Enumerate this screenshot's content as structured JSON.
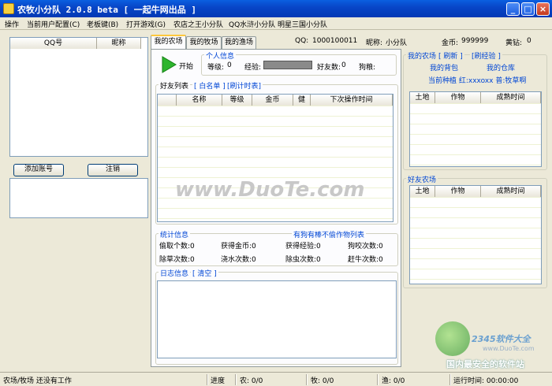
{
  "window": {
    "title": "农牧小分队 2.0.8 beta [ 一起牛网出品 ]"
  },
  "menu": [
    "操作",
    "当前用户配置(C)",
    "老板键(B)",
    "打开游戏(G)",
    "农店之王小分队",
    "QQ水浒小分队",
    "明星三国小分队"
  ],
  "accounts": {
    "col_qq": "QQ号",
    "col_nick": "昵称"
  },
  "buttons": {
    "add_account": "添加账号",
    "logout": "注销",
    "start": "开始"
  },
  "tabs": [
    "我的农场",
    "我的牧场",
    "我的渔场"
  ],
  "info_bar": {
    "qq_label": "QQ:",
    "qq_value": "1000100011",
    "nick_label": "昵称:",
    "nick_value": "小分队",
    "gold_label": "金币:",
    "gold_value": "999999",
    "diamond_label": "黄钻:",
    "diamond_value": "0"
  },
  "personal": {
    "title": "个人信息",
    "level_label": "等级:",
    "level_value": "0",
    "exp_label": "经验:",
    "exp_progress": 1.0,
    "friends_label": "好友数:",
    "friends_value": "0",
    "dogfood_label": "狗粮:"
  },
  "friends": {
    "title": "好友列表",
    "whitelist": "[ 白名单 ]",
    "schedule": "[刷计时表]",
    "cols": [
      "名称",
      "等级",
      "金币",
      "健",
      "下次操作时间"
    ]
  },
  "stats": {
    "title": "统计信息",
    "link": "有狗有棒不偷作物列表",
    "items": [
      {
        "label": "偷取个数:",
        "value": "0"
      },
      {
        "label": "获得金币:",
        "value": "0"
      },
      {
        "label": "获得经验:",
        "value": "0"
      },
      {
        "label": "狗咬次数:",
        "value": "0"
      },
      {
        "label": "除草次数:",
        "value": "0"
      },
      {
        "label": "浇水次数:",
        "value": "0"
      },
      {
        "label": "除虫次数:",
        "value": "0"
      },
      {
        "label": "赶牛次数:",
        "value": "0"
      }
    ]
  },
  "log": {
    "title": "日志信息",
    "clear": "[ 清空 ]"
  },
  "my_farm": {
    "title": "我的农场",
    "refresh": "[ 刷新 ]",
    "brush_exp": "[刷经验 ]",
    "bag": "我的背包",
    "warehouse": "我的仓库",
    "planting": "当前种植 红:xxxoxx 普:牧草啊",
    "cols": [
      "土地",
      "作物",
      "成熟时间"
    ]
  },
  "friend_farm": {
    "title": "好友农场",
    "cols": [
      "土地",
      "作物",
      "成熟时间"
    ]
  },
  "watermark": {
    "site": "www.DuoTe.com",
    "brand": "2345软件大全",
    "brand_url": "www.DuoTe.com",
    "slogan": "国内最安全的软件站"
  },
  "status": {
    "main": "农场/牧场 还没有工作",
    "progress_label": "进度",
    "farm": "农: 0/0",
    "pasture": "牧: 0/0",
    "fishery": "渔: 0/0",
    "runtime": "运行时间: 00:00:00"
  }
}
